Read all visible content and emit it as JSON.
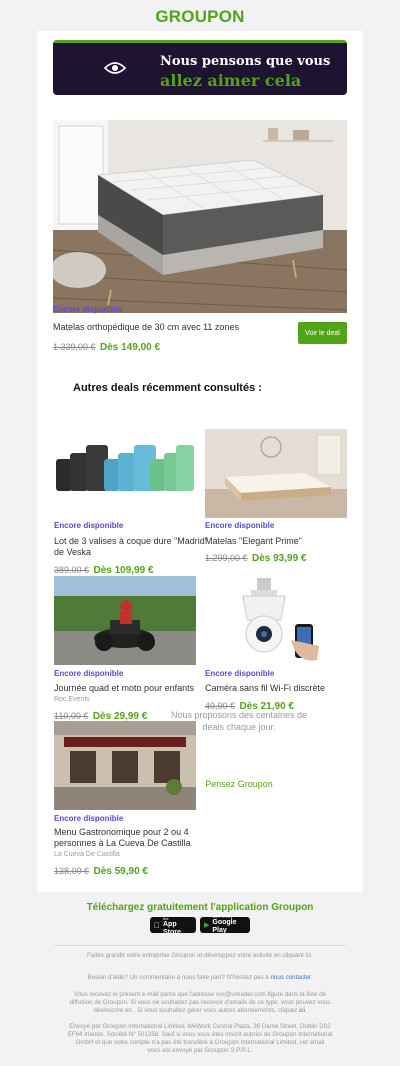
{
  "header": {
    "logo": "GROUPON"
  },
  "banner": {
    "line1": "Nous pensons que vous",
    "line2": "allez aimer cela"
  },
  "hero": {
    "availability": "Encore disponible",
    "title": "Matelas orthopédique de 30 cm avec 11 zones",
    "old_price": "1.339,00 €",
    "new_price": "Dès 149,00 €",
    "button": "Voir le deal"
  },
  "recent": {
    "heading": "Autres deals récemment consultés :",
    "items": [
      {
        "availability": "Encore disponible",
        "title1": "Lot de 3 valises à coque dure \"Madrid\"",
        "title2": "de Veska",
        "merchant": "",
        "old_price": "389,00 €",
        "new_price": "Dès 109,99 €"
      },
      {
        "availability": "Encore disponible",
        "title1": "Matelas \"Elegant Prime\"",
        "title2": "",
        "merchant": "",
        "old_price": "1.299,00 €",
        "new_price": "Dès 93,99 €"
      },
      {
        "availability": "Encore disponible",
        "title1": "Journée quad et moto pour enfants",
        "title2": "",
        "merchant": "Roc Events",
        "old_price": "110,00 €",
        "new_price": "Dès 29,99 €"
      },
      {
        "availability": "Encore disponible",
        "title1": "Caméra sans fil Wi-Fi discrète",
        "title2": "",
        "merchant": "",
        "old_price": "49,90 €",
        "new_price": "Dès 21,90 €"
      },
      {
        "availability": "Encore disponible",
        "title1": "Menu Gastronomique pour 2 ou 4",
        "title2": "personnes à La Cueva De Castilla",
        "merchant": "La Cueva De Castilla",
        "old_price": "138,00 €",
        "new_price": "Dès 59,90 €"
      }
    ]
  },
  "promo": {
    "line1": "Nous proposons des centaines de",
    "line2": "deals chaque jour.",
    "link": "Pensez Groupon"
  },
  "app": {
    "title": "Téléchargez gratuitement l'application Groupon",
    "appstore_small": "Download on the",
    "appstore_big": "App Store",
    "googleplay_small": "GET IT ON",
    "googleplay_big": "Google Play"
  },
  "footer": {
    "line1": "Faites grandir votre entreprise Groupon et développez votre activité en cliquant ici.",
    "help_text": "Besoin d'aide? Un commentaire à nous faire part? N'hésitez pas à",
    "help_link": "nous contacter",
    "help_end": ".",
    "reason1": "Vous recevez le présent e-mail parce que l'adresse xxx@ureader.com figure dans la liste de",
    "reason2": "diffusion de Groupon. Si vous ne souhaitez pas recevoir d'emails de ce type, vous pouvez vous",
    "reason3": "désinscrire en . Si vous souhaitez gérer vous autres abonnements, cliquez",
    "reason_link": "ici",
    "sent1": "Envoyé par Groupon International Limited, WeWork Central Plaza, 36 Dame Street, Dublin D02",
    "sent2": "EF64 Irlande. Société N° 501358. Sauf si vous vous êtes inscrit auprès de Groupon International",
    "sent3": "GmbH et que votre compte n'a pas été transféré à Groupon International Limited, cet email",
    "sent4": "vous est envoyé par Groupon S.P.R.L."
  },
  "colors": {
    "brand_green": "#53a318",
    "banner_bg": "#1e1330",
    "availability": "#5b4bd1"
  }
}
